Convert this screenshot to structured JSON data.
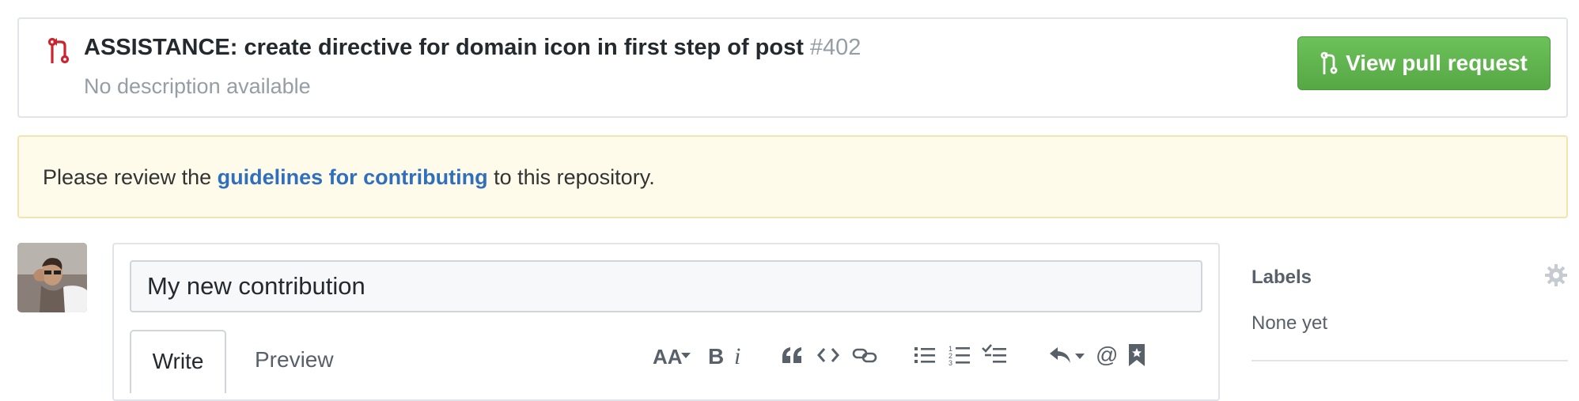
{
  "pull_request": {
    "title": "ASSISTANCE: create directive for domain icon in first step of post",
    "number": "#402",
    "description": "No description available",
    "view_button_label": "View pull request"
  },
  "flash": {
    "prefix": "Please review the ",
    "link_text": "guidelines for contributing",
    "suffix": " to this repository."
  },
  "composer": {
    "title_value": "My new contribution",
    "tabs": [
      {
        "label": "Write",
        "active": true
      },
      {
        "label": "Preview",
        "active": false
      }
    ],
    "toolbar": [
      "text-size-icon",
      "bold-icon",
      "italic-icon",
      "quote-icon",
      "code-icon",
      "link-icon",
      "bulleted-list-icon",
      "numbered-list-icon",
      "task-list-icon",
      "reply-icon",
      "mention-icon",
      "saved-reply-icon"
    ]
  },
  "sidebar": {
    "labels_heading": "Labels",
    "labels_value": "None yet"
  },
  "colors": {
    "accent_green": "#5cb54b",
    "link_blue": "#2f6fbe",
    "flash_bg": "#fffbea",
    "pr_icon_red": "#cb2431"
  }
}
